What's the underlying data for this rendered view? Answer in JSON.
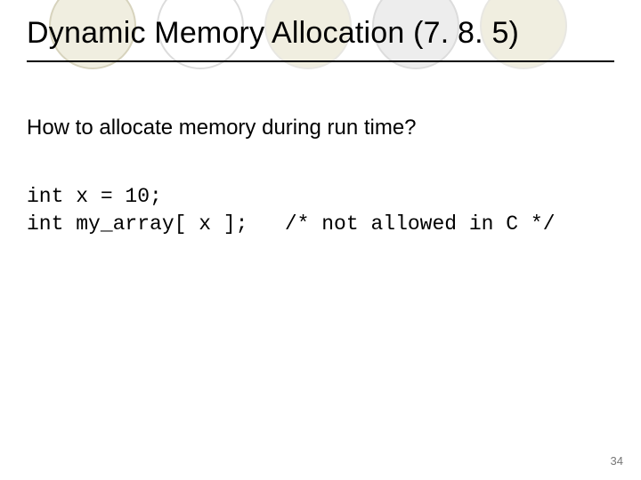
{
  "title": "Dynamic Memory Allocation (7. 8. 5)",
  "subhead": "How to allocate memory during run time?",
  "code": {
    "line1": "int x = 10;",
    "line2": "int my_array[ x ];   /* not allowed in C */"
  },
  "page_number": "34"
}
